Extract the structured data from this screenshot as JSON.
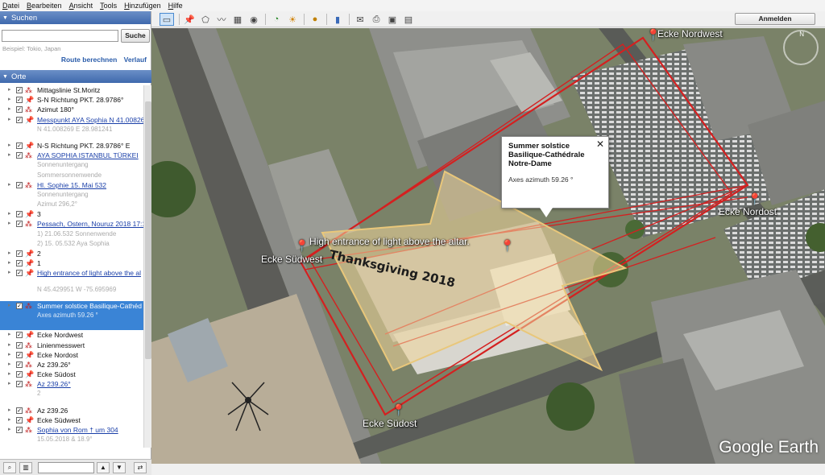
{
  "menu": [
    "Datei",
    "Bearbeiten",
    "Ansicht",
    "Tools",
    "Hinzufügen",
    "Hilfe"
  ],
  "toolbar": {
    "login_label": "Anmelden"
  },
  "search": {
    "header": "Suchen",
    "button": "Suche",
    "placeholder": "Beispiel: Tokio, Japan",
    "route": "Route berechnen",
    "history": "Verlauf"
  },
  "places": {
    "header": "Orte",
    "items": [
      {
        "text": "Mittagslinie St.Moritz",
        "kind": "path",
        "checked": true,
        "style": ""
      },
      {
        "text": "S-N Richtung PKT. 28.9786°",
        "kind": "pin",
        "checked": true,
        "style": ""
      },
      {
        "text": "Azimut 180°",
        "kind": "path",
        "checked": true,
        "style": ""
      },
      {
        "text": "Messpunkt AYA Sophia N 41.00826",
        "kind": "pin",
        "checked": true,
        "style": "link"
      },
      {
        "text": "N 41.008269 E 28.981241",
        "kind": "",
        "checked": null,
        "style": "sub"
      },
      {
        "text": "",
        "kind": "",
        "checked": null,
        "style": "gap"
      },
      {
        "text": "N-S Richtung PKT. 28.9786° E",
        "kind": "pin",
        "checked": true,
        "style": ""
      },
      {
        "text": "AYA SOPHIA ISTANBUL TÜRKEI",
        "kind": "path",
        "checked": true,
        "style": "link"
      },
      {
        "text": "Sonnenuntergang",
        "kind": "",
        "checked": null,
        "style": "sub"
      },
      {
        "text": "Sommersonnenwende",
        "kind": "",
        "checked": null,
        "style": "sub"
      },
      {
        "text": "Hl. Sophie 15. Mai 532",
        "kind": "path",
        "checked": true,
        "style": "link"
      },
      {
        "text": "Sonnenuntergang",
        "kind": "",
        "checked": null,
        "style": "sub"
      },
      {
        "text": "Azimut 296,2°",
        "kind": "",
        "checked": null,
        "style": "sub"
      },
      {
        "text": "3",
        "kind": "pin",
        "checked": true,
        "style": ""
      },
      {
        "text": "Pessach, Ostern, Nouruz 2018 17:15",
        "kind": "path",
        "checked": true,
        "style": "link"
      },
      {
        "text": "1) 21.06.532 Sonnenwende",
        "kind": "",
        "checked": null,
        "style": "sub"
      },
      {
        "text": "2) 15. 05.532 Aya Sophia",
        "kind": "",
        "checked": null,
        "style": "sub"
      },
      {
        "text": "2",
        "kind": "pin",
        "checked": true,
        "style": ""
      },
      {
        "text": "1",
        "kind": "pin",
        "checked": true,
        "style": ""
      },
      {
        "text": "High entrance of light above the al",
        "kind": "pin",
        "checked": true,
        "style": "link"
      },
      {
        "text": "",
        "kind": "",
        "checked": null,
        "style": "gap"
      },
      {
        "text": "N 45.429951 W -75.695969",
        "kind": "",
        "checked": null,
        "style": "sub"
      },
      {
        "text": "",
        "kind": "",
        "checked": null,
        "style": "gap"
      },
      {
        "text": "Summer solstice Basilique-Cathéd",
        "kind": "path",
        "checked": true,
        "style": "hl"
      },
      {
        "text": "Axes azimuth 59.26 °",
        "kind": "",
        "checked": null,
        "style": "hl-sub"
      },
      {
        "text": "",
        "kind": "",
        "checked": null,
        "style": "hl-sub"
      },
      {
        "text": "Ecke Nordwest",
        "kind": "pin",
        "checked": true,
        "style": ""
      },
      {
        "text": "Linienmesswert",
        "kind": "path",
        "checked": true,
        "style": ""
      },
      {
        "text": "Ecke Nordost",
        "kind": "pin",
        "checked": true,
        "style": ""
      },
      {
        "text": "Az 239.26°",
        "kind": "path",
        "checked": true,
        "style": ""
      },
      {
        "text": "Ecke Südost",
        "kind": "pin",
        "checked": true,
        "style": ""
      },
      {
        "text": "Az 239.26°",
        "kind": "path",
        "checked": true,
        "style": "link"
      },
      {
        "text": "2",
        "kind": "",
        "checked": null,
        "style": "sub"
      },
      {
        "text": "",
        "kind": "",
        "checked": null,
        "style": "gap"
      },
      {
        "text": "Az 239.26",
        "kind": "path",
        "checked": true,
        "style": ""
      },
      {
        "text": "Ecke Südwest",
        "kind": "pin",
        "checked": true,
        "style": ""
      },
      {
        "text": "Sophia von Rom † um 304",
        "kind": "path",
        "checked": true,
        "style": "link"
      },
      {
        "text": "15.05.2018 & 18.9°",
        "kind": "",
        "checked": null,
        "style": "sub"
      }
    ]
  },
  "map": {
    "labels": {
      "nw": "Ecke Nordwest",
      "no": "Ecke Nordost",
      "sw": "Ecke Südwest",
      "so": "Ecke Südost",
      "altar": "High entrance of light above the altar."
    },
    "overlay_text": "Thanksgiving 2018",
    "popup": {
      "title1": "Summer solstice",
      "title2": "Basilique-Cathédrale",
      "title3": "Notre-Dame",
      "desc": "Axes azimuth 59.26 °"
    },
    "brand": "Google Earth",
    "compass_n": "N",
    "colors": {
      "outline": "#d42020",
      "arrow_fill": "#f4d9a0",
      "pin": "#f3d200"
    }
  }
}
